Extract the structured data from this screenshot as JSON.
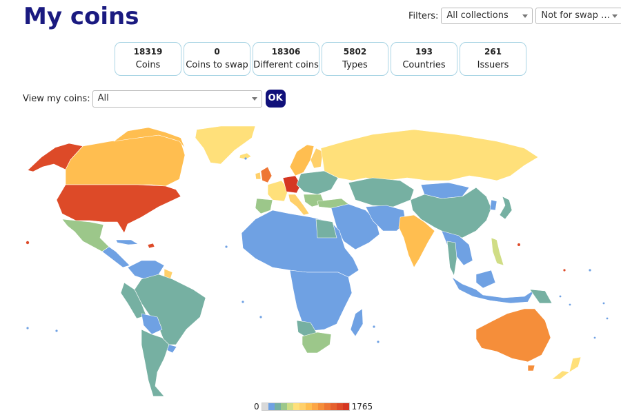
{
  "page": {
    "title": "My coins"
  },
  "filters": {
    "label": "Filters:",
    "collections": "All collections",
    "swap": "Not for swap …"
  },
  "stats": [
    {
      "value": "18319",
      "label": "Coins"
    },
    {
      "value": "0",
      "label": "Coins to swap"
    },
    {
      "value": "18306",
      "label": "Different coins"
    },
    {
      "value": "5802",
      "label": "Types"
    },
    {
      "value": "193",
      "label": "Countries"
    },
    {
      "value": "261",
      "label": "Issuers"
    }
  ],
  "view": {
    "label": "View my coins:",
    "value": "All",
    "ok": "OK"
  },
  "legend": {
    "min": "0",
    "max": "1765",
    "colors": [
      "#d9d9d9",
      "#6fa1e3",
      "#76b0a2",
      "#9cc78a",
      "#d0dd85",
      "#ffe07a",
      "#ffd06a",
      "#ffbe50",
      "#fca646",
      "#f58e3a",
      "#ee7634",
      "#e5602e",
      "#dd4a28",
      "#d53622"
    ]
  }
}
